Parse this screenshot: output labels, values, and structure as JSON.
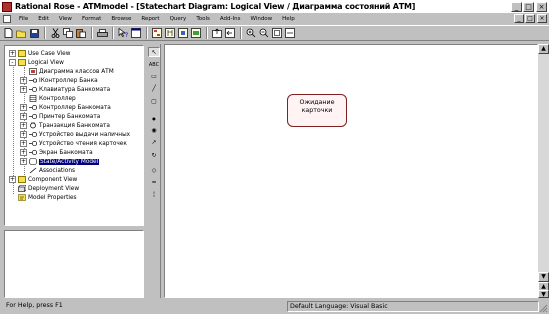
{
  "window": {
    "title": "Rational Rose - ATMmodel - [Statechart Diagram: Logical View / Диаграмма состояний АТМ]",
    "buttons": {
      "minimize": "_",
      "maximize": "□",
      "close": "×"
    }
  },
  "menu": {
    "items": [
      "File",
      "Edit",
      "View",
      "Format",
      "Browse",
      "Report",
      "Query",
      "Tools",
      "Add-Ins",
      "Window",
      "Help"
    ]
  },
  "toolbar": {
    "buttons": [
      "new-icon",
      "open-icon",
      "save-icon",
      "cut-icon",
      "copy-icon",
      "paste-icon",
      "print-icon",
      "context-help-icon",
      "view-doc-icon",
      "browse-class-diagram-icon",
      "browse-interaction-diagram-icon",
      "browse-component-diagram-icon",
      "browse-deployment-diagram-icon",
      "browse-parent-icon",
      "browse-previous-icon",
      "zoom-in-icon",
      "zoom-out-icon",
      "fit-in-window-icon",
      "undo-fit-icon"
    ]
  },
  "browser": {
    "items": [
      {
        "label": "Use Case View",
        "level": 0,
        "expander": "+",
        "icon": "folder-icon"
      },
      {
        "label": "Logical View",
        "level": 0,
        "expander": "-",
        "icon": "folder-icon"
      },
      {
        "label": "Диаграмма классов АТМ",
        "level": 1,
        "expander": "",
        "icon": "class-diagram-icon"
      },
      {
        "label": "IКонтроллер Банка",
        "level": 1,
        "expander": "+",
        "icon": "interface-icon"
      },
      {
        "label": "Клавиатура Банкомата",
        "level": 1,
        "expander": "+",
        "icon": "class-icon"
      },
      {
        "label": "Контроллер",
        "level": 1,
        "expander": "",
        "icon": "class-icon"
      },
      {
        "label": "Контроллер Банкомата",
        "level": 1,
        "expander": "+",
        "icon": "class-icon"
      },
      {
        "label": "Принтер Банкомата",
        "level": 1,
        "expander": "+",
        "icon": "class-icon"
      },
      {
        "label": "Транзакция Банкомата",
        "level": 1,
        "expander": "+",
        "icon": "class-icon"
      },
      {
        "label": "Устройство выдачи наличных",
        "level": 1,
        "expander": "+",
        "icon": "class-icon"
      },
      {
        "label": "Устройство чтения карточек",
        "level": 1,
        "expander": "+",
        "icon": "class-icon"
      },
      {
        "label": "Экран Банкомата",
        "level": 1,
        "expander": "+",
        "icon": "class-icon"
      },
      {
        "label": "State/Activity Model",
        "level": 1,
        "expander": "+",
        "icon": "state-model-icon",
        "selected": true
      },
      {
        "label": "Associations",
        "level": 1,
        "expander": "",
        "icon": "association-icon"
      },
      {
        "label": "Component View",
        "level": 0,
        "expander": "+",
        "icon": "folder-icon"
      },
      {
        "label": "Deployment View",
        "level": 0,
        "expander": "",
        "icon": "deployment-icon"
      },
      {
        "label": "Model Properties",
        "level": 0,
        "expander": "",
        "icon": "properties-icon"
      }
    ]
  },
  "toolbox": {
    "tools": [
      {
        "name": "selection-tool",
        "glyph": "↖",
        "active": true
      },
      {
        "name": "text-tool",
        "glyph": "ABC"
      },
      {
        "name": "note-tool",
        "glyph": "▭"
      },
      {
        "name": "anchor-note-tool",
        "glyph": "╱"
      },
      {
        "name": "state-tool",
        "glyph": "▢"
      },
      {
        "name": "start-state-tool",
        "glyph": "●"
      },
      {
        "name": "end-state-tool",
        "glyph": "◉"
      },
      {
        "name": "transition-tool",
        "glyph": "↗"
      },
      {
        "name": "self-transition-tool",
        "glyph": "↻"
      },
      {
        "name": "decision-tool",
        "glyph": "◇"
      },
      {
        "name": "sync-tool",
        "glyph": "━"
      },
      {
        "name": "swimlane-tool",
        "glyph": "¦"
      },
      {
        "name": "object-flow-tool",
        "glyph": "◇"
      }
    ]
  },
  "diagram": {
    "state_name_line1": "Ожидание",
    "state_name_line2": "карточки"
  },
  "status": {
    "help": "For Help, press F1",
    "language": "Default Language: Visual Basic"
  }
}
